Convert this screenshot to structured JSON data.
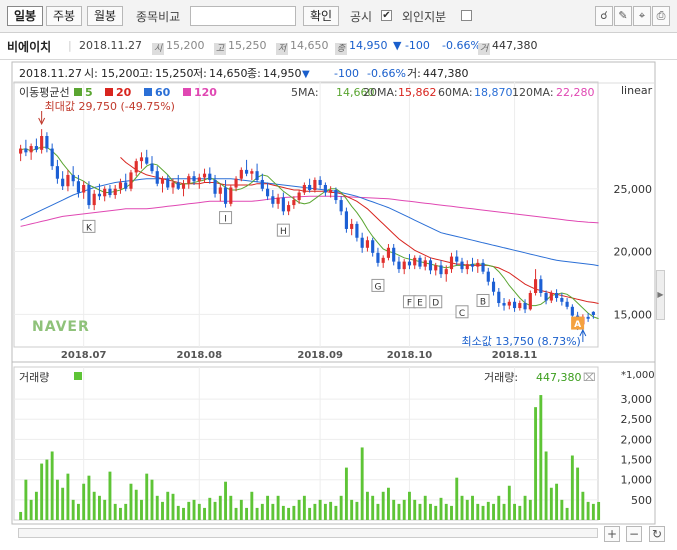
{
  "toolbar": {
    "daily": "일봉",
    "weekly": "주봉",
    "monthly": "월봉",
    "compare_label": "종목비교",
    "compare_value": "",
    "confirm": "확인",
    "disclosure": "공시",
    "foreign": "외인지분",
    "disclosure_checked": "✔",
    "foreign_checked": ""
  },
  "info": {
    "name": "비에이치",
    "date": "2018.11.27",
    "open_tag": "시",
    "open": "15,200",
    "high_tag": "고",
    "high": "15,250",
    "low_tag": "저",
    "low": "14,650",
    "close_tag": "종",
    "close": "14,950",
    "change": "▼ -100",
    "change_pct": "-0.66%",
    "volume_tag": "거",
    "volume": "447,380"
  },
  "colors": {
    "up": "#e0302d",
    "down": "#1c5fd4",
    "ma5": "#5aa531",
    "ma20": "#d8251f",
    "ma60": "#2b6fd6",
    "ma120": "#e048b3",
    "volume": "#5ec436",
    "accent": "#1a5fcc"
  },
  "chart_data": {
    "type": "candlestick",
    "header_line": {
      "date": "2018.11.27",
      "open_label": "시:",
      "open": "15,200",
      "high_label": "고:",
      "high": "15,250",
      "low_label": "저:",
      "low": "14,650",
      "close_label": "종:",
      "close": "14,950",
      "arrow": "▼",
      "change": "-100",
      "change_pct": "-0.66%",
      "volume_label": "거:",
      "volume": "447,380"
    },
    "ma_title": "이동평균선",
    "ma_legend": [
      {
        "label": "5",
        "color": "#5aa531"
      },
      {
        "label": "20",
        "color": "#d8251f"
      },
      {
        "label": "60",
        "color": "#2b6fd6"
      },
      {
        "label": "120",
        "color": "#e048b3"
      }
    ],
    "ma_values": [
      {
        "label": "5MA:",
        "value": "14,660",
        "color": "#5aa531"
      },
      {
        "label": "20MA:",
        "value": "15,862",
        "color": "#d8251f"
      },
      {
        "label": "60MA:",
        "value": "18,870",
        "color": "#2b6fd6"
      },
      {
        "label": "120MA:",
        "value": "22,280",
        "color": "#e048b3"
      }
    ],
    "scale_label": "linear",
    "watermark": "NAVER",
    "price_ylim": [
      12400,
      33500
    ],
    "price_ticks": [
      {
        "v": 25000,
        "label": "25,000"
      },
      {
        "v": 20000,
        "label": "20,000"
      },
      {
        "v": 15000,
        "label": "15,000"
      }
    ],
    "x_ticks": [
      {
        "i": 12,
        "label": "2018.07"
      },
      {
        "i": 34,
        "label": "2018.08"
      },
      {
        "i": 57,
        "label": "2018.09"
      },
      {
        "i": 74,
        "label": "2018.10"
      },
      {
        "i": 94,
        "label": "2018.11"
      }
    ],
    "max_annotation": {
      "i": 4,
      "text": "최대값 29,750 (-49.75%)"
    },
    "min_annotation": {
      "i": 107,
      "text": "최소값 13,750 (8.73%)"
    },
    "markers": [
      {
        "i": 13,
        "label": "K",
        "price": 22800
      },
      {
        "i": 39,
        "label": "I",
        "price": 23500
      },
      {
        "i": 50,
        "label": "H",
        "price": 22500
      },
      {
        "i": 68,
        "label": "G",
        "price": 18100
      },
      {
        "i": 74,
        "label": "F",
        "price": 16800
      },
      {
        "i": 76,
        "label": "E",
        "price": 16800
      },
      {
        "i": 79,
        "label": "D",
        "price": 16800
      },
      {
        "i": 84,
        "label": "C",
        "price": 16000
      },
      {
        "i": 88,
        "label": "B",
        "price": 16900
      },
      {
        "i": 106,
        "label": "A",
        "price": 15100
      }
    ],
    "ohlc": [
      [
        27800,
        28500,
        27200,
        28200
      ],
      [
        28200,
        28900,
        27600,
        27900
      ],
      [
        27900,
        28600,
        27300,
        28400
      ],
      [
        28400,
        29000,
        27900,
        28100
      ],
      [
        28100,
        29750,
        27800,
        29200
      ],
      [
        29200,
        29500,
        27900,
        28200
      ],
      [
        28200,
        28600,
        26500,
        26800
      ],
      [
        26800,
        27300,
        25400,
        25800
      ],
      [
        25800,
        26400,
        24900,
        25200
      ],
      [
        25200,
        26500,
        24800,
        26100
      ],
      [
        26100,
        26800,
        25200,
        25600
      ],
      [
        25600,
        26100,
        24300,
        24700
      ],
      [
        24700,
        25600,
        24200,
        25300
      ],
      [
        25300,
        25600,
        23400,
        23700
      ],
      [
        23700,
        24900,
        23300,
        24600
      ],
      [
        24600,
        25400,
        24100,
        24400
      ],
      [
        24400,
        25200,
        24000,
        25000
      ],
      [
        25000,
        25300,
        24300,
        24500
      ],
      [
        24500,
        25300,
        24200,
        25000
      ],
      [
        25000,
        25800,
        24600,
        25500
      ],
      [
        25500,
        26200,
        24800,
        25000
      ],
      [
        25000,
        26500,
        24800,
        26300
      ],
      [
        26300,
        27400,
        26000,
        27200
      ],
      [
        27200,
        27900,
        26600,
        27500
      ],
      [
        27500,
        28100,
        26900,
        27000
      ],
      [
        27000,
        27600,
        26200,
        26400
      ],
      [
        26400,
        26800,
        25200,
        25400
      ],
      [
        25400,
        26000,
        24700,
        25800
      ],
      [
        25800,
        26100,
        24900,
        25100
      ],
      [
        25100,
        25800,
        24600,
        25500
      ],
      [
        25500,
        26100,
        24900,
        25000
      ],
      [
        25000,
        25700,
        24400,
        25400
      ],
      [
        25400,
        26200,
        25000,
        26000
      ],
      [
        26000,
        26400,
        25300,
        25600
      ],
      [
        25600,
        26200,
        25000,
        25900
      ],
      [
        25900,
        26600,
        25500,
        26200
      ],
      [
        26200,
        26700,
        25400,
        25700
      ],
      [
        25700,
        26100,
        24300,
        24600
      ],
      [
        24600,
        25400,
        24000,
        25100
      ],
      [
        25100,
        25700,
        23500,
        23800
      ],
      [
        23800,
        25300,
        23600,
        25100
      ],
      [
        25100,
        26000,
        24800,
        25800
      ],
      [
        25800,
        26700,
        25600,
        26500
      ],
      [
        26500,
        27300,
        26000,
        26200
      ],
      [
        26200,
        26600,
        25700,
        26400
      ],
      [
        26400,
        27000,
        25500,
        25700
      ],
      [
        25700,
        26200,
        24800,
        25000
      ],
      [
        25000,
        25500,
        24100,
        24400
      ],
      [
        24400,
        24900,
        23500,
        23800
      ],
      [
        23800,
        24600,
        23400,
        24300
      ],
      [
        24300,
        24700,
        22900,
        23200
      ],
      [
        23200,
        24000,
        22900,
        23700
      ],
      [
        23700,
        24400,
        23400,
        24100
      ],
      [
        24100,
        24900,
        23800,
        24700
      ],
      [
        24700,
        25500,
        24500,
        25300
      ],
      [
        25300,
        25800,
        24700,
        24900
      ],
      [
        24900,
        25900,
        24700,
        25700
      ],
      [
        25700,
        26000,
        25000,
        25300
      ],
      [
        25300,
        25500,
        24400,
        24700
      ],
      [
        24700,
        25200,
        24300,
        24900
      ],
      [
        24900,
        25100,
        23800,
        24100
      ],
      [
        24100,
        24400,
        22900,
        23200
      ],
      [
        23200,
        23500,
        21500,
        21800
      ],
      [
        21800,
        22600,
        21300,
        22200
      ],
      [
        22200,
        22400,
        20800,
        21100
      ],
      [
        21100,
        21500,
        19900,
        20300
      ],
      [
        20300,
        21200,
        20000,
        20900
      ],
      [
        20900,
        21100,
        19600,
        19900
      ],
      [
        19900,
        20300,
        18800,
        19100
      ],
      [
        19100,
        19700,
        18700,
        19500
      ],
      [
        19500,
        20600,
        19300,
        20300
      ],
      [
        20300,
        20600,
        18900,
        19200
      ],
      [
        19200,
        19600,
        18300,
        18600
      ],
      [
        18600,
        19400,
        18200,
        19200
      ],
      [
        19200,
        19800,
        18600,
        18900
      ],
      [
        18900,
        19700,
        18600,
        19500
      ],
      [
        19500,
        19700,
        18600,
        18800
      ],
      [
        18800,
        19600,
        18500,
        19300
      ],
      [
        19300,
        19500,
        18200,
        18500
      ],
      [
        18500,
        19100,
        18100,
        18900
      ],
      [
        18900,
        19300,
        17900,
        18200
      ],
      [
        18200,
        18900,
        17600,
        18600
      ],
      [
        18600,
        19900,
        18300,
        19600
      ],
      [
        19600,
        20100,
        18900,
        19200
      ],
      [
        19200,
        19500,
        18300,
        18600
      ],
      [
        18600,
        19300,
        18200,
        19000
      ],
      [
        19000,
        19500,
        18400,
        18800
      ],
      [
        18800,
        19400,
        18300,
        19100
      ],
      [
        19100,
        19400,
        18200,
        18400
      ],
      [
        18400,
        18700,
        17300,
        17600
      ],
      [
        17600,
        17900,
        16500,
        16800
      ],
      [
        16800,
        17100,
        15600,
        15900
      ],
      [
        15900,
        16300,
        15300,
        15700
      ],
      [
        15700,
        16200,
        15400,
        16000
      ],
      [
        16000,
        16300,
        15200,
        15500
      ],
      [
        15500,
        16100,
        15300,
        15900
      ],
      [
        15900,
        16200,
        15100,
        15400
      ],
      [
        15400,
        16900,
        15300,
        16700
      ],
      [
        16700,
        18600,
        16500,
        17800
      ],
      [
        17800,
        18100,
        16400,
        16700
      ],
      [
        16700,
        16900,
        15800,
        16100
      ],
      [
        16100,
        16900,
        15900,
        16700
      ],
      [
        16700,
        17000,
        16000,
        16300
      ],
      [
        16300,
        16700,
        15700,
        16000
      ],
      [
        16000,
        16300,
        15400,
        15600
      ],
      [
        15600,
        15800,
        14700,
        14900
      ],
      [
        14900,
        15200,
        13750,
        14200
      ],
      [
        14200,
        15000,
        14000,
        14800
      ],
      [
        14800,
        15100,
        14400,
        14650
      ],
      [
        15200,
        15250,
        14650,
        14950
      ]
    ],
    "ma5": [
      28100,
      28200,
      28000,
      28200,
      28300,
      28300,
      28000,
      27600,
      27000,
      26500,
      26000,
      25800,
      25600,
      25300,
      25100,
      24900,
      24700,
      24700,
      24800,
      24900,
      25100,
      25400,
      25900,
      26400,
      26800,
      27000,
      26900,
      26500,
      26100,
      25600,
      25300,
      25400,
      25400,
      25500,
      25600,
      25700,
      25900,
      25700,
      25400,
      25100,
      24900,
      24900,
      25000,
      25200,
      25500,
      25900,
      26100,
      26000,
      25600,
      25200,
      24800,
      24500,
      24200,
      23900,
      23800,
      23900,
      24200,
      24500,
      24800,
      25000,
      25000,
      24700,
      24200,
      23600,
      23100,
      22500,
      21800,
      21200,
      20700,
      20200,
      20000,
      19900,
      19700,
      19500,
      19400,
      19300,
      19200,
      19100,
      19000,
      18900,
      18800,
      18700,
      18800,
      18900,
      18900,
      18900,
      19000,
      19000,
      19000,
      18900,
      18800,
      18400,
      17900,
      17300,
      16800,
      16300,
      15900,
      15700,
      15700,
      15800,
      16100,
      16500,
      16600,
      16700,
      16600,
      16300,
      15900,
      15500,
      15100,
      14800,
      14660
    ],
    "ma20": [
      null,
      null,
      null,
      null,
      null,
      null,
      null,
      null,
      null,
      null,
      null,
      null,
      null,
      null,
      null,
      null,
      null,
      null,
      null,
      27500,
      27100,
      26800,
      26500,
      26300,
      26100,
      26000,
      25900,
      25800,
      25700,
      25600,
      25500,
      25400,
      25400,
      25400,
      25400,
      25500,
      25500,
      25500,
      25400,
      25300,
      25300,
      25300,
      25300,
      25300,
      25300,
      25400,
      25400,
      25400,
      25300,
      25200,
      25100,
      25000,
      24900,
      24900,
      24800,
      24800,
      24800,
      24800,
      24800,
      24700,
      24700,
      24600,
      24400,
      24200,
      24000,
      23700,
      23400,
      23000,
      22600,
      22200,
      21800,
      21400,
      21000,
      20700,
      20400,
      20100,
      19900,
      19700,
      19500,
      19400,
      19300,
      19200,
      19100,
      19000,
      19000,
      18900,
      18900,
      18900,
      18900,
      18900,
      18800,
      18700,
      18500,
      18300,
      18000,
      17700,
      17400,
      17200,
      17000,
      16900,
      16800,
      16700,
      16600,
      16500,
      16400,
      16300,
      16200,
      16100,
      16000,
      15950,
      15862
    ],
    "ma60": [
      22500,
      22700,
      22900,
      23100,
      23300,
      23500,
      23700,
      23900,
      24100,
      24300,
      24500,
      24650,
      24800,
      24950,
      25100,
      25200,
      25300,
      25400,
      25500,
      25550,
      25600,
      25650,
      25700,
      25750,
      25800,
      25800,
      25800,
      25800,
      25800,
      25800,
      25800,
      25800,
      25800,
      25800,
      25800,
      25800,
      25800,
      25800,
      25800,
      25800,
      25800,
      25750,
      25700,
      25650,
      25600,
      25550,
      25500,
      25450,
      25400,
      25350,
      25300,
      25250,
      25200,
      25150,
      25100,
      25050,
      25000,
      24950,
      24900,
      24850,
      24800,
      24700,
      24600,
      24500,
      24400,
      24250,
      24100,
      23950,
      23800,
      23650,
      23500,
      23300,
      23100,
      22900,
      22700,
      22500,
      22300,
      22100,
      21900,
      21700,
      21500,
      21400,
      21300,
      21200,
      21100,
      21000,
      20900,
      20800,
      20700,
      20600,
      20500,
      20400,
      20300,
      20200,
      20100,
      20000,
      19900,
      19800,
      19700,
      19600,
      19500,
      19400,
      19300,
      19250,
      19200,
      19150,
      19100,
      19050,
      19000,
      18950,
      18870
    ],
    "ma120": [
      22000,
      22100,
      22200,
      22300,
      22400,
      22500,
      22600,
      22700,
      22800,
      22850,
      22900,
      22950,
      23000,
      23050,
      23100,
      23150,
      23200,
      23250,
      23300,
      23350,
      23400,
      23400,
      23400,
      23400,
      23400,
      23450,
      23500,
      23550,
      23600,
      23650,
      23700,
      23750,
      23800,
      23850,
      23900,
      23950,
      24000,
      24000,
      24000,
      24000,
      24000,
      24000,
      24000,
      24000,
      24000,
      24050,
      24100,
      24150,
      24200,
      24250,
      24300,
      24320,
      24340,
      24360,
      24380,
      24400,
      24400,
      24400,
      24400,
      24400,
      24400,
      24380,
      24360,
      24340,
      24320,
      24300,
      24280,
      24260,
      24240,
      24220,
      24200,
      24150,
      24100,
      24050,
      24000,
      23950,
      23900,
      23850,
      23800,
      23750,
      23700,
      23650,
      23600,
      23550,
      23500,
      23450,
      23400,
      23350,
      23300,
      23250,
      23200,
      23150,
      23100,
      23050,
      23000,
      22950,
      22900,
      22850,
      22800,
      22750,
      22700,
      22650,
      22600,
      22550,
      22500,
      22450,
      22400,
      22380,
      22340,
      22310,
      22280
    ],
    "volume_title": "거래량",
    "volume_value_label": "거래량:",
    "volume_value": "447,380",
    "volume_unit": "*1,000",
    "volume_ylim": [
      0,
      3300
    ],
    "volume_ticks": [
      {
        "v": 500,
        "label": "500"
      },
      {
        "v": 1000,
        "label": "1,000"
      },
      {
        "v": 1500,
        "label": "1,500"
      },
      {
        "v": 2000,
        "label": "2,000"
      },
      {
        "v": 2500,
        "label": "2,500"
      },
      {
        "v": 3000,
        "label": "3,000"
      }
    ],
    "volume": [
      200,
      1000,
      500,
      700,
      1400,
      1500,
      1700,
      1000,
      800,
      1150,
      500,
      400,
      900,
      1100,
      700,
      600,
      500,
      1200,
      400,
      300,
      400,
      900,
      750,
      500,
      1150,
      1000,
      600,
      450,
      700,
      650,
      350,
      300,
      450,
      500,
      400,
      300,
      550,
      450,
      600,
      950,
      600,
      300,
      500,
      300,
      700,
      300,
      400,
      600,
      400,
      600,
      350,
      300,
      350,
      500,
      600,
      300,
      400,
      500,
      400,
      450,
      350,
      600,
      1300,
      500,
      450,
      1800,
      700,
      600,
      400,
      700,
      800,
      500,
      400,
      500,
      700,
      500,
      400,
      600,
      400,
      350,
      550,
      400,
      350,
      1050,
      600,
      500,
      600,
      400,
      350,
      450,
      400,
      600,
      400,
      850,
      400,
      350,
      600,
      500,
      2800,
      3100,
      1700,
      800,
      900,
      500,
      300,
      1600,
      1300,
      700,
      450,
      400,
      447
    ]
  }
}
